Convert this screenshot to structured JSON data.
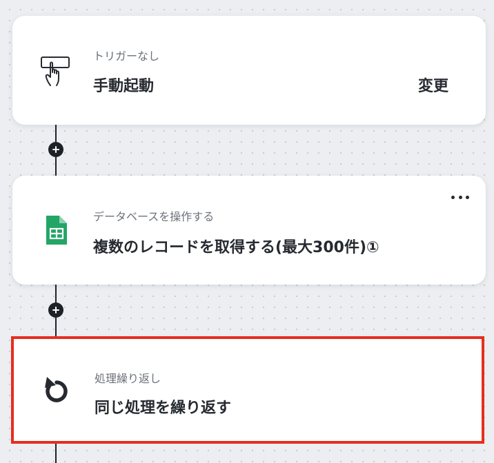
{
  "flow": {
    "steps": [
      {
        "caption": "トリガーなし",
        "title": "手動起動",
        "action_label": "変更",
        "icon": "hand-pointer-icon"
      },
      {
        "caption": "データベースを操作する",
        "title": "複数のレコードを取得する(最大300件)①",
        "icon": "google-sheets-icon",
        "menu_icon": "more-horizontal-icon"
      },
      {
        "caption": "処理繰り返し",
        "title": "同じ処理を繰り返す",
        "icon": "loop-arrow-icon",
        "highlighted": true
      }
    ]
  },
  "colors": {
    "canvas": "#eceef1",
    "card": "#ffffff",
    "text_primary": "#262a30",
    "text_secondary": "#6b7078",
    "connector": "#1e2228",
    "highlight_border": "#e52e20",
    "sheets_green": "#23a566"
  }
}
